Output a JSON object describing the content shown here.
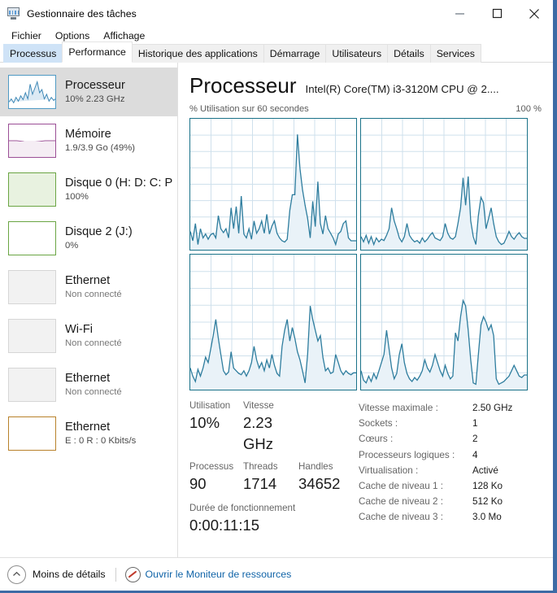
{
  "window": {
    "title": "Gestionnaire des tâches",
    "icon": "task-manager-icon",
    "minimize": "—",
    "maximize": "▢",
    "close": "✕"
  },
  "menu": {
    "items": [
      {
        "label": "Fichier"
      },
      {
        "label": "Options"
      },
      {
        "label": "Affichage"
      }
    ]
  },
  "tabs": {
    "items": [
      {
        "label": "Processus",
        "state": "hover"
      },
      {
        "label": "Performance",
        "state": "active"
      },
      {
        "label": "Historique des applications",
        "state": "normal"
      },
      {
        "label": "Démarrage",
        "state": "normal"
      },
      {
        "label": "Utilisateurs",
        "state": "normal"
      },
      {
        "label": "Détails",
        "state": "normal"
      },
      {
        "label": "Services",
        "state": "normal"
      }
    ]
  },
  "sidebar": {
    "items": [
      {
        "title": "Processeur",
        "sub": "10%  2.23 GHz",
        "kind": "cpu",
        "selected": true
      },
      {
        "title": "Mémoire",
        "sub": "1.9/3.9 Go (49%)",
        "kind": "memory",
        "selected": false
      },
      {
        "title": "Disque 0 (H: D: C: P",
        "sub": "100%",
        "kind": "disk-full",
        "selected": false
      },
      {
        "title": "Disque 2 (J:)",
        "sub": "0%",
        "kind": "disk",
        "selected": false
      },
      {
        "title": "Ethernet",
        "sub": "Non connecté",
        "kind": "ethernet",
        "selected": false
      },
      {
        "title": "Wi-Fi",
        "sub": "Non connecté",
        "kind": "wifi",
        "selected": false
      },
      {
        "title": "Ethernet",
        "sub": "Non connecté",
        "kind": "ethernet",
        "selected": false
      },
      {
        "title": "Ethernet",
        "sub": "E : 0 R : 0 Kbits/s",
        "kind": "ethernet-active",
        "selected": false
      }
    ]
  },
  "main": {
    "title": "Processeur",
    "model": "Intel(R) Core(TM) i3-3120M CPU @ 2....",
    "axis_left": "% Utilisation sur 60 secondes",
    "axis_right": "100 %",
    "stats": {
      "labels": {
        "utilisation": "Utilisation",
        "vitesse": "Vitesse",
        "processus": "Processus",
        "threads": "Threads",
        "handles": "Handles",
        "uptime": "Durée de fonctionnement"
      },
      "values": {
        "utilisation": "10%",
        "vitesse": "2.23 GHz",
        "processus": "90",
        "threads": "1714",
        "handles": "34652",
        "uptime": "0:00:11:15"
      }
    },
    "specs": [
      {
        "key": "Vitesse maximale :",
        "value": "2.50 GHz"
      },
      {
        "key": "Sockets :",
        "value": "1"
      },
      {
        "key": "Cœurs :",
        "value": "2"
      },
      {
        "key": "Processeurs logiques :",
        "value": "4"
      },
      {
        "key": "Virtualisation :",
        "value": "Activé"
      },
      {
        "key": "Cache de niveau 1 :",
        "value": "128 Ko"
      },
      {
        "key": "Cache de niveau 2 :",
        "value": "512 Ko"
      },
      {
        "key": "Cache de niveau 3 :",
        "value": "3.0 Mo"
      }
    ]
  },
  "footer": {
    "less_details": "Moins de détails",
    "resource_monitor": "Ouvrir le Moniteur de ressources"
  },
  "colors": {
    "cpu_line": "#2e7d9e",
    "cpu_fill": "#e9f2f8",
    "graph_border": "#1a7289",
    "grid": "#cfe0ec",
    "memory": "#9b4f96",
    "disk": "#6aa543",
    "ethernet_active": "#b8812a",
    "link": "#1164a8",
    "window_frame": "#3d6ba5"
  },
  "chart_data": [
    {
      "type": "area",
      "title": "CPU 0 — % Utilisation sur 60 secondes",
      "ylim": [
        0,
        100
      ],
      "xlim": [
        0,
        60
      ],
      "ylabel": "% Utilisation",
      "xlabel": "60 secondes",
      "grid": true,
      "values": [
        14,
        7,
        20,
        4,
        16,
        9,
        12,
        8,
        10,
        13,
        9,
        26,
        11,
        13,
        10,
        9,
        30,
        12,
        33,
        11,
        41,
        10,
        9,
        12,
        8,
        22,
        10,
        13,
        16,
        12,
        27,
        11,
        18,
        22,
        12,
        9,
        7,
        6,
        8,
        30,
        42,
        42,
        88,
        62,
        46,
        34,
        25,
        9,
        28,
        18,
        52,
        20,
        12,
        26,
        16,
        12,
        9,
        7,
        4,
        9,
        14,
        20,
        22,
        9,
        7
      ]
    },
    {
      "type": "area",
      "title": "CPU 1 — % Utilisation sur 60 secondes",
      "ylim": [
        0,
        100
      ],
      "xlim": [
        0,
        60
      ],
      "grid": true,
      "values": [
        10,
        6,
        11,
        5,
        10,
        4,
        9,
        6,
        8,
        7,
        11,
        16,
        30,
        22,
        14,
        9,
        7,
        10,
        20,
        11,
        8,
        6,
        7,
        5,
        9,
        6,
        8,
        11,
        13,
        9,
        8,
        7,
        10,
        20,
        12,
        9,
        8,
        10,
        20,
        30,
        55,
        34,
        56,
        22,
        10,
        4,
        26,
        40,
        36,
        16,
        24,
        30,
        20,
        10,
        6,
        4,
        5,
        8,
        12,
        9,
        6,
        5,
        7,
        10,
        8
      ]
    },
    {
      "type": "area",
      "title": "CPU 2 — % Utilisation sur 60 secondes",
      "ylim": [
        0,
        100
      ],
      "xlim": [
        0,
        60
      ],
      "grid": true,
      "values": [
        16,
        10,
        6,
        13,
        8,
        14,
        22,
        18,
        30,
        40,
        52,
        38,
        26,
        14,
        11,
        13,
        28,
        16,
        14,
        12,
        11,
        14,
        10,
        14,
        20,
        32,
        22,
        16,
        20,
        14,
        22,
        16,
        26,
        18,
        12,
        10,
        32,
        44,
        52,
        36,
        46,
        38,
        28,
        22,
        14,
        5,
        26,
        62,
        52,
        42,
        34,
        38,
        24,
        14,
        10,
        12,
        26,
        20,
        14,
        11,
        14,
        12,
        11,
        13,
        12
      ]
    },
    {
      "type": "area",
      "title": "CPU 3 — % Utilisation sur 60 secondes",
      "ylim": [
        0,
        100
      ],
      "xlim": [
        0,
        60
      ],
      "grid": true,
      "values": [
        14,
        7,
        5,
        10,
        6,
        12,
        8,
        14,
        20,
        26,
        44,
        30,
        16,
        8,
        12,
        26,
        34,
        20,
        12,
        8,
        6,
        9,
        7,
        10,
        14,
        22,
        16,
        13,
        18,
        26,
        20,
        14,
        10,
        18,
        12,
        8,
        10,
        42,
        36,
        54,
        66,
        60,
        44,
        22,
        7,
        4,
        26,
        50,
        56,
        52,
        44,
        48,
        40,
        20,
        6,
        4,
        5,
        6,
        8,
        10,
        14,
        18,
        14,
        10,
        9
      ]
    }
  ]
}
